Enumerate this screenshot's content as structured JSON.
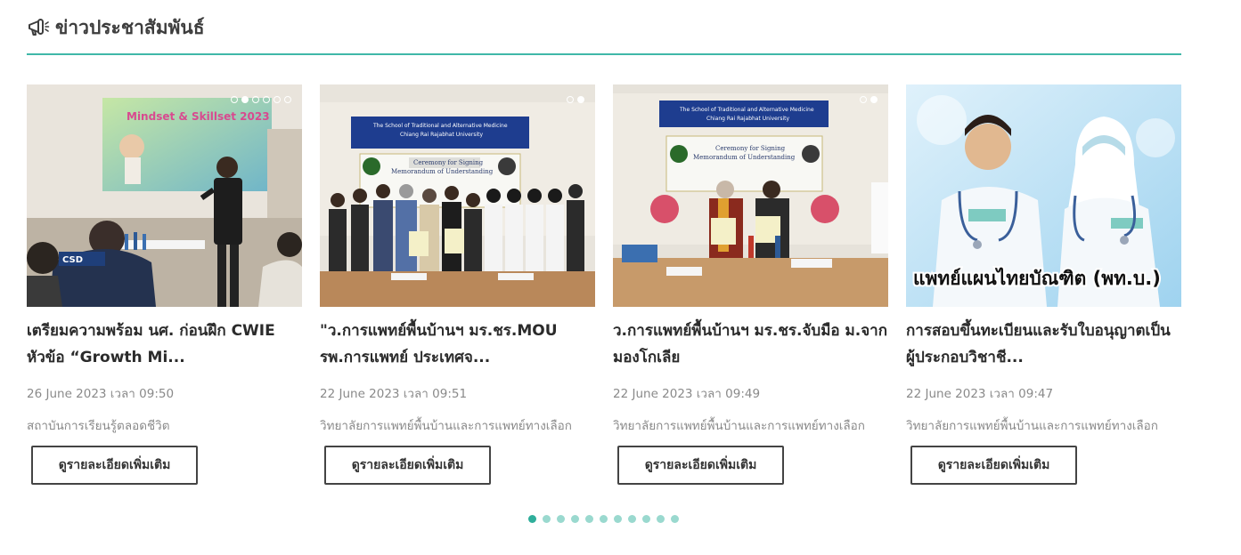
{
  "section": {
    "title": "ข่าวประชาสัมพันธ์",
    "icon": "megaphone-icon",
    "accent_color": "#3fb8a8"
  },
  "button_label": "ดูรายละเอียดเพิ่มเติม",
  "cards": [
    {
      "title_line1": "เตรียมความพร้อม นศ. ก่อนฝึก CWIE",
      "title_line2": "หัวข้อ “Growth Mi...",
      "date": "26 June 2023 เวลา 09:50",
      "org": "สถาบันการเรียนรู้ตลอดชีวิต",
      "img_text": "Mindset & Skillset 2023",
      "img_badge": "CSD",
      "slide_dots": 6,
      "active_dot": 2
    },
    {
      "title_line1": "\"ว.การแพทย์พื้นบ้านฯ มร.ชร.MOU",
      "title_line2": "รพ.การแพทย์ ประเทศจ...",
      "date": "22 June 2023 เวลา 09:51",
      "org": "วิทยาลัยการแพทย์พื้นบ้านและการแพทย์ทางเลือก",
      "banner_1": "The School of Traditional and Alternative Medicine",
      "banner_2": "Chiang Rai Rajabhat University",
      "banner_3": "Ceremony for Signing",
      "banner_4": "Memorandum of Understanding",
      "slide_dots": 2,
      "active_dot": 2
    },
    {
      "title_line1": "ว.การแพทย์พื้นบ้านฯ มร.ชร.จับมือ ม.จาก",
      "title_line2": "มองโกเลีย",
      "date": "22 June 2023 เวลา 09:49",
      "org": "วิทยาลัยการแพทย์พื้นบ้านและการแพทย์ทางเลือก",
      "banner_1": "The School of Traditional and Alternative Medicine",
      "banner_2": "Chiang Rai Rajabhat University",
      "banner_3": "Ceremony for Signing",
      "banner_4": "Memorandum of Understanding",
      "slide_dots": 2,
      "active_dot": 2
    },
    {
      "title_line1": "การสอบขึ้นทะเบียนและรับใบอนุญาตเป็น",
      "title_line2": "ผู้ประกอบวิชาชี...",
      "date": "22 June 2023 เวลา 09:47",
      "org": "วิทยาลัยการแพทย์พื้นบ้านและการแพทย์ทางเลือก",
      "img_caption": "แพทย์แผนไทยบัณฑิต (พท.บ.)",
      "slide_dots": 0,
      "active_dot": 0
    }
  ],
  "pager": {
    "count": 11,
    "active": 1,
    "active_color": "#2fae9b",
    "inactive_color": "#9ad9cf"
  }
}
